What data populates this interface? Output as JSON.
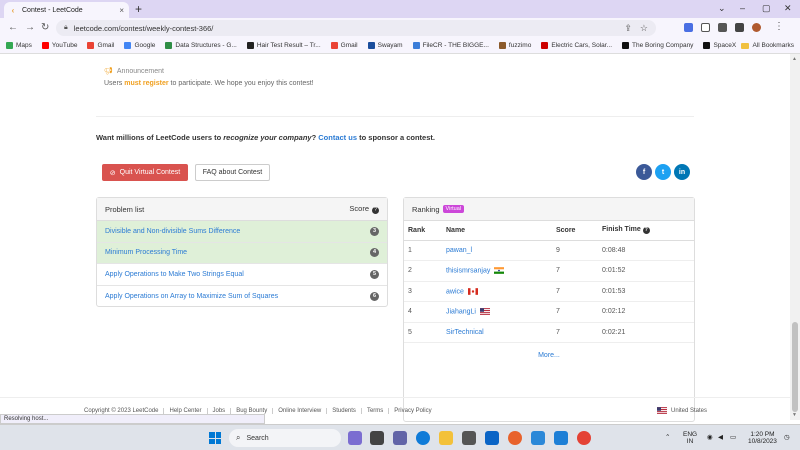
{
  "browser": {
    "tab_title": "Contest - LeetCode",
    "url": "leetcode.com/contest/weekly-contest-366/",
    "bookmarks": [
      {
        "label": "Maps",
        "color": "#34a853"
      },
      {
        "label": "YouTube",
        "color": "#ff0000"
      },
      {
        "label": "Gmail",
        "color": "#ea4335"
      },
      {
        "label": "Google",
        "color": "#4285f4"
      },
      {
        "label": "Data Structures - G...",
        "color": "#2f8d46"
      },
      {
        "label": "Hair Test Result – Tr...",
        "color": "#222222"
      },
      {
        "label": "Gmail",
        "color": "#ea4335"
      },
      {
        "label": "Swayam",
        "color": "#1a4d9c"
      },
      {
        "label": "FileCR - THE BIGGE...",
        "color": "#3b7dd8"
      },
      {
        "label": "fuzzimo",
        "color": "#8b5a2b"
      },
      {
        "label": "Electric Cars, Solar...",
        "color": "#cc0000"
      },
      {
        "label": "The Boring Company",
        "color": "#111111"
      },
      {
        "label": "SpaceX",
        "color": "#111111"
      }
    ],
    "all_bookmarks": "All Bookmarks",
    "status_text": "Resolving host..."
  },
  "announcement": {
    "title": "Announcement",
    "text_before": "Users ",
    "must_register": "must register",
    "text_after": " to participate. We hope you enjoy this contest!"
  },
  "sponsor": {
    "prefix": "Want millions of LeetCode users to ",
    "emphasis": "recognize your company",
    "mid": "? ",
    "contact": "Contact us",
    "suffix": " to sponsor a contest."
  },
  "buttons": {
    "quit": "Quit Virtual Contest",
    "faq": "FAQ about Contest"
  },
  "social": [
    {
      "name": "facebook",
      "glyph": "f",
      "color": "#3b5998"
    },
    {
      "name": "twitter",
      "glyph": "t",
      "color": "#1da1f2"
    },
    {
      "name": "linkedin",
      "glyph": "in",
      "color": "#0077b5"
    }
  ],
  "problem_list": {
    "title": "Problem list",
    "score_label": "Score",
    "problems": [
      {
        "name": "Divisible and Non-divisible Sums Difference",
        "score": "3",
        "solved": true
      },
      {
        "name": "Minimum Processing Time",
        "score": "4",
        "solved": true
      },
      {
        "name": "Apply Operations to Make Two Strings Equal",
        "score": "5",
        "solved": false
      },
      {
        "name": "Apply Operations on Array to Maximize Sum of Squares",
        "score": "6",
        "solved": false
      }
    ]
  },
  "ranking": {
    "title": "Ranking",
    "badge": "Virtual",
    "columns": [
      "Rank",
      "Name",
      "Score",
      "Finish Time"
    ],
    "rows": [
      {
        "rank": "1",
        "name": "pawan_l",
        "flag": "",
        "score": "9",
        "time": "0:08:48"
      },
      {
        "rank": "2",
        "name": "thisismrsanjay",
        "flag": "india",
        "score": "7",
        "time": "0:01:52"
      },
      {
        "rank": "3",
        "name": "awice",
        "flag": "canada",
        "score": "7",
        "time": "0:01:53"
      },
      {
        "rank": "4",
        "name": "JiahangLi",
        "flag": "usa",
        "score": "7",
        "time": "0:02:12"
      },
      {
        "rank": "5",
        "name": "SirTechnical",
        "flag": "",
        "score": "7",
        "time": "0:02:21"
      }
    ],
    "more": "More..."
  },
  "footer": {
    "copyright": "Copyright © 2023 LeetCode",
    "links": [
      "Help Center",
      "Jobs",
      "Bug Bounty",
      "Online Interview",
      "Students",
      "Terms",
      "Privacy Policy"
    ],
    "locale": "United States"
  },
  "taskbar": {
    "search_placeholder": "Search",
    "lang_top": "ENG",
    "lang_bottom": "IN",
    "time": "1:20 PM",
    "date": "10/8/2023"
  }
}
